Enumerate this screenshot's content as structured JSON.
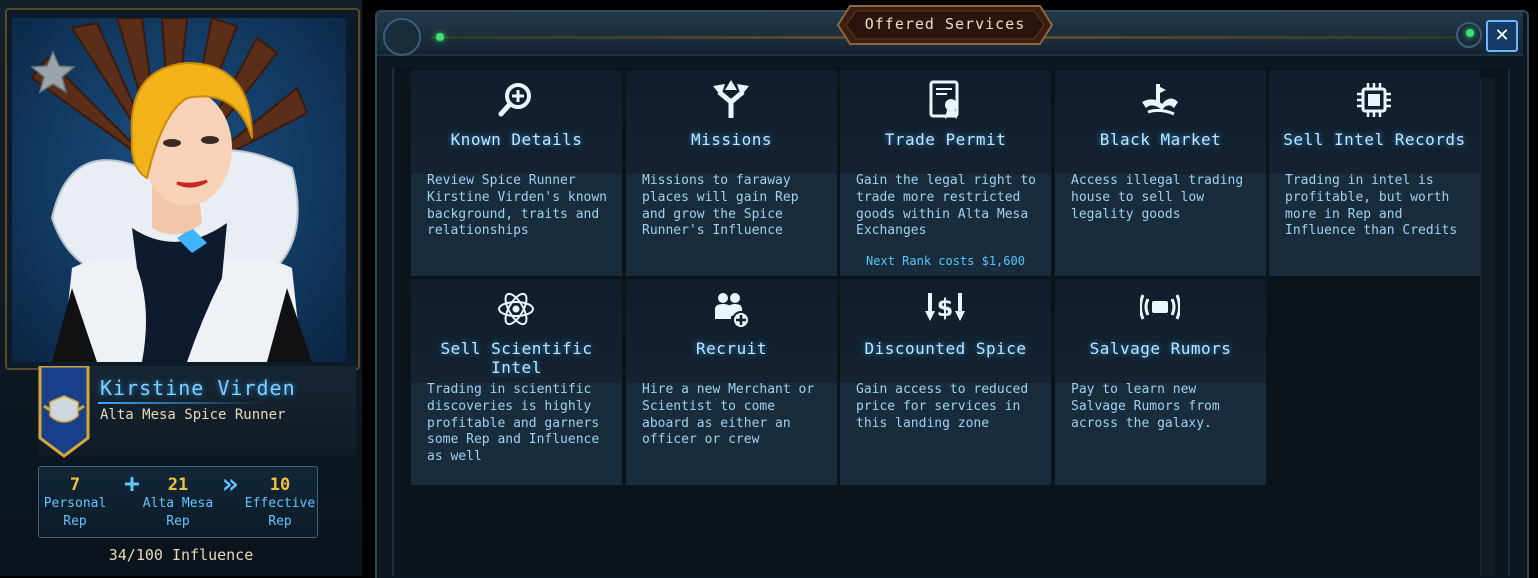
{
  "character": {
    "name": "Kirstine Virden",
    "title": "Alta Mesa Spice Runner",
    "rep": {
      "personal": {
        "value": "7",
        "label_line1": "Personal",
        "label_line2": "Rep"
      },
      "alta_mesa": {
        "value": "21",
        "label_line1": "Alta Mesa",
        "label_line2": "Rep"
      },
      "effective": {
        "value": "10",
        "label_line1": "Effective",
        "label_line2": "Rep"
      },
      "plus_symbol": "+",
      "arrow_symbol": "»"
    },
    "influence": "34/100 Influence"
  },
  "window": {
    "title": "Offered Services",
    "close_label": "✕"
  },
  "services": [
    {
      "title": "Known Details",
      "icon": "magnify-plus-icon",
      "description": "Review Spice Runner Kirstine Virden's known background, traits and relationships"
    },
    {
      "title": "Missions",
      "icon": "split-arrows-icon",
      "description": "Missions to faraway places will gain Rep and grow the Spice Runner's Influence"
    },
    {
      "title": "Trade Permit",
      "icon": "certificate-icon",
      "description": "Gain the legal right to trade more restricted goods within Alta Mesa Exchanges",
      "cost": "Next Rank costs $1,600"
    },
    {
      "title": "Black Market",
      "icon": "black-market-icon",
      "description": "Access illegal trading house to sell low legality goods"
    },
    {
      "title": "Sell Intel Records",
      "icon": "chip-icon",
      "description": "Trading in intel is profitable, but worth more in Rep and Influence than Credits"
    },
    {
      "title": "Sell Scientific Intel",
      "icon": "atom-icon",
      "description": "Trading in scientific discoveries is highly profitable and garners some Rep and Influence as well"
    },
    {
      "title": "Recruit",
      "icon": "recruit-group-icon",
      "description": "Hire a new Merchant or Scientist to come aboard as either an officer or crew"
    },
    {
      "title": "Discounted Spice",
      "icon": "dollar-arrows-icon",
      "description": "Gain access to reduced price for services in this landing zone"
    },
    {
      "title": "Salvage Rumors",
      "icon": "signal-wave-icon",
      "description": "Pay to learn new Salvage Rumors from across the galaxy."
    }
  ],
  "colors": {
    "accent_blue": "#63c4ff",
    "gold": "#f2c040",
    "card_bg": "#182c3b",
    "close_button": "#143a66"
  }
}
